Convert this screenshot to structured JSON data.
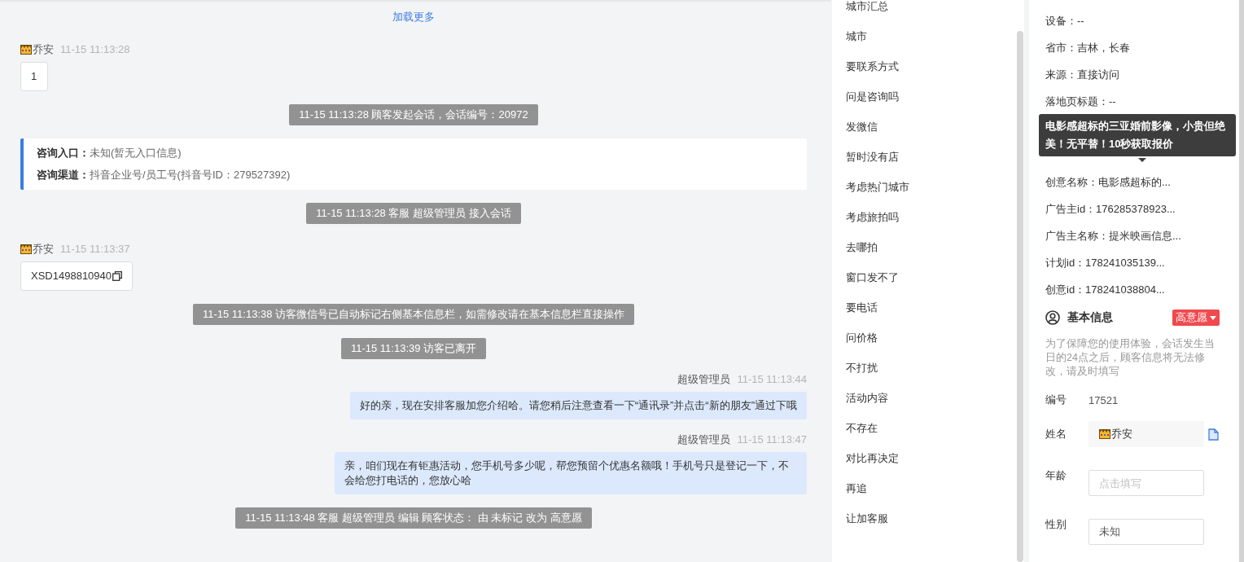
{
  "chat": {
    "load_more": "加载更多",
    "messages": [
      {
        "kind": "customer",
        "name": "乔安",
        "time": "11-15 11:13:28",
        "text": "1",
        "copyable": false
      },
      {
        "kind": "system",
        "text": "11-15 11:13:28 顾客发起会话，会话编号：20972"
      },
      {
        "kind": "entry",
        "rows": [
          {
            "label": "咨询入口：",
            "value": "未知(暂无入口信息)"
          },
          {
            "label": "咨询渠道：",
            "value": "抖音企业号/员工号(抖音号ID：279527392)"
          }
        ]
      },
      {
        "kind": "system",
        "text": "11-15 11:13:28 客服 超级管理员 接入会话"
      },
      {
        "kind": "customer",
        "name": "乔安",
        "time": "11-15 11:13:37",
        "text": "XSD1498810940",
        "copyable": true
      },
      {
        "kind": "system",
        "text": "11-15 11:13:38 访客微信号已自动标记右侧基本信息栏，如需修改请在基本信息栏直接操作"
      },
      {
        "kind": "system",
        "text": "11-15 11:13:39 访客已离开"
      },
      {
        "kind": "agent",
        "name": "超级管理员",
        "time": "11-15 11:13:44",
        "text": "好的亲，现在安排客服加您介绍哈。请您稍后注意查看一下“通讯录”并点击“新的朋友”通过下哦"
      },
      {
        "kind": "agent",
        "name": "超级管理员",
        "time": "11-15 11:13:47",
        "text": "亲，咱们现在有钜惠活动，您手机号多少呢，帮您预留个优惠名额哦！手机号只是登记一下，不会给您打电话的，您放心哈"
      },
      {
        "kind": "system",
        "text": "11-15 11:13:48 客服 超级管理员 编辑 顾客状态： 由 未标记 改为 高意愿"
      }
    ]
  },
  "quick_replies": [
    "城市汇总",
    "城市",
    "要联系方式",
    "问是咨询吗",
    "发微信",
    "暂时没有店",
    "考虑热门城市",
    "考虑旅拍吗",
    "去哪拍",
    "窗口发不了",
    "要电话",
    "问价格",
    "不打扰",
    "活动内容",
    "不存在",
    "对比再决定",
    "再追",
    "让加客服"
  ],
  "source_info": {
    "rows": [
      "设备：--",
      "省市：吉林，长春",
      "来源：直接访问",
      "落地页标题：--"
    ],
    "tooltip": "电影感超标的三亚婚前影像，小贵但绝美！无平替！10秒获取报价",
    "rows_after": [
      "创意名称：电影感超标的...",
      "广告主id：176285378923...",
      "广告主名称：提米映画信息...",
      "计划id：178241035139...",
      "创意id：178241038804..."
    ]
  },
  "basic_info": {
    "title": "基本信息",
    "intent_tag": "高意愿",
    "note": "为了保障您的使用体验，会话发生当日的24点之后，顾客信息将无法修改，请及时填写",
    "fields": [
      {
        "kind": "text",
        "label": "编号",
        "value": "17521"
      },
      {
        "kind": "name",
        "label": "姓名",
        "value": "乔安"
      },
      {
        "kind": "input",
        "label": "年龄",
        "placeholder": "点击填写"
      },
      {
        "kind": "input",
        "label": "性别",
        "value": "未知"
      }
    ]
  }
}
